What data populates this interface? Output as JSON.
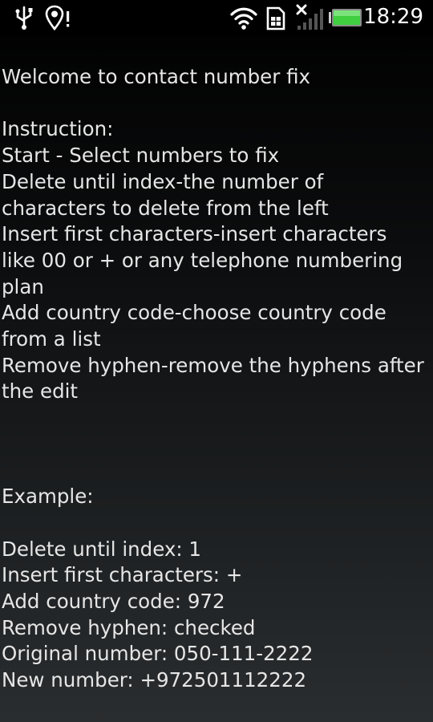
{
  "status_bar": {
    "time": "18:29",
    "icons": [
      "usb-icon",
      "location-alert-icon",
      "wifi-icon",
      "sim-icon",
      "no-signal-icon",
      "battery-icon"
    ],
    "accent_battery": "#3fcf3f"
  },
  "content": {
    "welcome": "Welcome to contact number fix",
    "instruction_heading": "Instruction:",
    "instructions": [
      "Start - Select numbers to fix",
      "Delete until index-the number of",
      "characters to delete from the left",
      "Insert first characters-insert characters",
      "like 00 or + or any telephone numbering",
      "plan",
      "Add country code-choose country code",
      "from a list",
      "Remove hyphen-remove the hyphens after",
      "the edit"
    ],
    "example_heading": "Example:",
    "example_lines": [
      "Delete until index: 1",
      "Insert first characters: +",
      "Add country code: 972",
      "Remove hyphen: checked",
      "Original number: 050-111-2222",
      "New number: +972501112222"
    ]
  }
}
